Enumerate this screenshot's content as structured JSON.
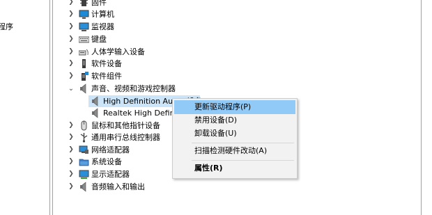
{
  "left_pane": {
    "visible_text": "程序"
  },
  "tree": {
    "items": [
      {
        "label": "固件",
        "icon": "firmware-icon",
        "expanded": false
      },
      {
        "label": "计算机",
        "icon": "computer-icon",
        "expanded": false
      },
      {
        "label": "监视器",
        "icon": "monitor-icon",
        "expanded": false
      },
      {
        "label": "键盘",
        "icon": "keyboard-icon",
        "expanded": false
      },
      {
        "label": "人体学输入设备",
        "icon": "hid-icon",
        "expanded": false
      },
      {
        "label": "软件设备",
        "icon": "software-device-icon",
        "expanded": false
      },
      {
        "label": "软件组件",
        "icon": "software-component-icon",
        "expanded": false
      },
      {
        "label": "声音、视频和游戏控制器",
        "icon": "speaker-icon",
        "expanded": true
      },
      {
        "label": "鼠标和其他指针设备",
        "icon": "mouse-icon",
        "expanded": false
      },
      {
        "label": "通用串行总线控制器",
        "icon": "usb-icon",
        "expanded": false
      },
      {
        "label": "网络适配器",
        "icon": "network-icon",
        "expanded": false
      },
      {
        "label": "系统设备",
        "icon": "system-folder-icon",
        "expanded": false
      },
      {
        "label": "显示适配器",
        "icon": "display-adapter-icon",
        "expanded": false
      },
      {
        "label": "音频输入和输出",
        "icon": "audio-io-icon",
        "expanded": false
      }
    ],
    "children": [
      {
        "label": "High Definition Audio 设备",
        "icon": "speaker-icon",
        "selected": true
      },
      {
        "label": "Realtek High Definition Audio",
        "icon": "speaker-icon",
        "selected": false
      }
    ]
  },
  "context_menu": {
    "items": [
      {
        "label": "更新驱动程序(P)",
        "highlighted": true
      },
      {
        "label": "禁用设备(D)"
      },
      {
        "label": "卸载设备(U)"
      },
      {
        "label": "扫描检测硬件改动(A)"
      },
      {
        "label": "属性(R)",
        "bold": true
      }
    ]
  },
  "colors": {
    "selection": "#cce4f7",
    "menu_hover": "#91c9f7",
    "menu_bg": "#f2f2f2"
  }
}
